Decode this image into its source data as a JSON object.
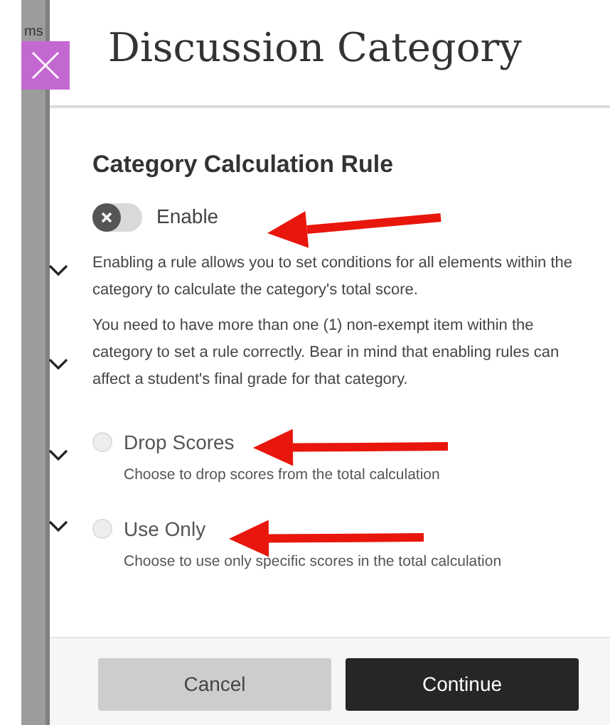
{
  "sidebar": {
    "label": "ms"
  },
  "dialog": {
    "title": "Discussion Category",
    "section_title": "Category Calculation Rule",
    "toggle": {
      "label": "Enable",
      "on": false
    },
    "paragraphs": [
      "Enabling a rule allows you to set conditions for all elements within the category to calculate the category's total score.",
      "You need to have more than one (1) non-exempt item within the category to set a rule correctly. Bear in mind that enabling rules can affect a student's final grade for that category."
    ],
    "options": [
      {
        "label": "Drop Scores",
        "description": "Choose to drop scores from the total calculation",
        "selected": false
      },
      {
        "label": "Use Only",
        "description": "Choose to use only specific scores in the total calculation",
        "selected": false
      }
    ],
    "buttons": [
      {
        "label": "Cancel",
        "kind": "secondary"
      },
      {
        "label": "Continue",
        "kind": "primary"
      }
    ]
  }
}
